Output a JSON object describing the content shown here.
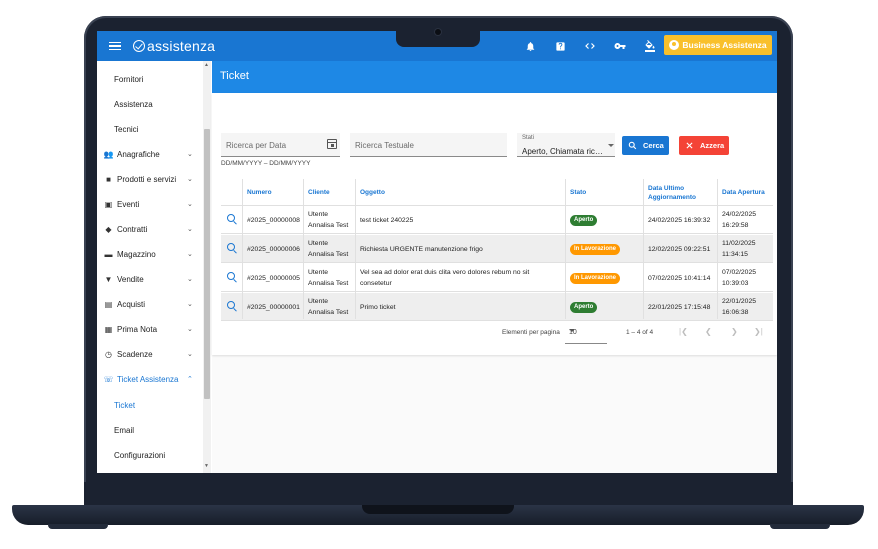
{
  "app": {
    "logo_text": "assistenza",
    "business_button": "Business Assistenza"
  },
  "sidebar": {
    "items": [
      {
        "label": "Fornitori"
      },
      {
        "label": "Assistenza"
      },
      {
        "label": "Tecnici"
      },
      {
        "label": "Anagrafiche"
      },
      {
        "label": "Prodotti e servizi"
      },
      {
        "label": "Eventi"
      },
      {
        "label": "Contratti"
      },
      {
        "label": "Magazzino"
      },
      {
        "label": "Vendite"
      },
      {
        "label": "Acquisti"
      },
      {
        "label": "Prima Nota"
      },
      {
        "label": "Scadenze"
      },
      {
        "label": "Ticket Assistenza"
      },
      {
        "label": "Ticket"
      },
      {
        "label": "Email"
      },
      {
        "label": "Configurazioni"
      }
    ]
  },
  "page": {
    "title": "Ticket"
  },
  "filters": {
    "date_placeholder": "Ricerca per Data",
    "date_hint": "DD/MM/YYYY – DD/MM/YYYY",
    "text_placeholder": "Ricerca Testuale",
    "status_label": "Stati",
    "status_value": "Aperto, Chiamata ricevuta",
    "search_button": "Cerca",
    "reset_button": "Azzera"
  },
  "table": {
    "headers": {
      "numero": "Numero",
      "cliente": "Cliente",
      "oggetto": "Oggetto",
      "stato": "Stato",
      "aggiornamento_1": "Data Ultimo",
      "aggiornamento_2": "Aggiornamento",
      "apertura": "Data Apertura"
    },
    "rows": [
      {
        "numero": "#2025_00000008",
        "cliente_1": "Utente",
        "cliente_2": "Annalisa Test",
        "oggetto_1": "test ticket 240225",
        "oggetto_2": "",
        "stato": "Aperto",
        "aggiornamento": "24/02/2025 16:39:32",
        "apertura_1": "24/02/2025",
        "apertura_2": "16:29:58"
      },
      {
        "numero": "#2025_00000006",
        "cliente_1": "Utente",
        "cliente_2": "Annalisa Test",
        "oggetto_1": "Richiesta URGENTE manutenzione frigo",
        "oggetto_2": "",
        "stato": "In Lavorazione",
        "aggiornamento": "12/02/2025 09:22:51",
        "apertura_1": "11/02/2025",
        "apertura_2": "11:34:15"
      },
      {
        "numero": "#2025_00000005",
        "cliente_1": "Utente",
        "cliente_2": "Annalisa Test",
        "oggetto_1": "Vel sea ad dolor erat duis clita vero dolores rebum no sit",
        "oggetto_2": "consetetur",
        "stato": "In Lavorazione",
        "aggiornamento": "07/02/2025 10:41:14",
        "apertura_1": "07/02/2025",
        "apertura_2": "10:39:03"
      },
      {
        "numero": "#2025_00000001",
        "cliente_1": "Utente",
        "cliente_2": "Annalisa Test",
        "oggetto_1": "Primo ticket",
        "oggetto_2": "",
        "stato": "Aperto",
        "aggiornamento": "22/01/2025 17:15:48",
        "apertura_1": "22/01/2025",
        "apertura_2": "16:06:38"
      }
    ]
  },
  "paginator": {
    "label": "Elementi per pagina",
    "page_size": "10",
    "range": "1 – 4 of 4"
  },
  "colors": {
    "primary": "#1976d2",
    "header": "#1e88e5",
    "accent": "#f9c02b",
    "danger": "#f44336",
    "status_open": "#2e7d32",
    "status_working": "#ff9800"
  }
}
